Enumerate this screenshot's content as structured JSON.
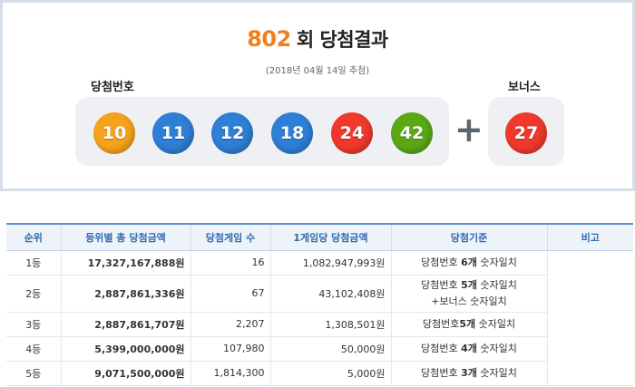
{
  "draw": {
    "number": "802",
    "title_suffix": "회 당첨결과",
    "date": "(2018년 04월 14일 추첨)",
    "main_label": "당첨번호",
    "bonus_label": "보너스",
    "plus_symbol": "+",
    "numbers": [
      "10",
      "11",
      "12",
      "18",
      "24",
      "42"
    ],
    "bonus": "27"
  },
  "ball_colors": {
    "yellow": "#fbc400",
    "blue": "#69c8f2",
    "red": "#ff7272",
    "green": "#b0d840",
    "main": [
      "#f6a21c",
      "#2e7fd6",
      "#2e7fd6",
      "#2e7fd6",
      "#f0392c",
      "#5aa816"
    ],
    "bonus": "#f0392c"
  },
  "table": {
    "headers": [
      "순위",
      "등위별 총 당첨금액",
      "당첨게임 수",
      "1게임당 당첨금액",
      "당첨기준",
      "비고"
    ],
    "rows": [
      {
        "rank": "1등",
        "total": "17,327,167,888원",
        "games": "16",
        "per_game": "1,082,947,993원",
        "criteria_pre": "당첨번호 ",
        "criteria_bold": "6개",
        "criteria_post": " 숫자일치",
        "criteria_line2": ""
      },
      {
        "rank": "2등",
        "total": "2,887,861,336원",
        "games": "67",
        "per_game": "43,102,408원",
        "criteria_pre": "당첨번호 ",
        "criteria_bold": "5개",
        "criteria_post": " 숫자일치",
        "criteria_line2": "+보너스 숫자일치"
      },
      {
        "rank": "3등",
        "total": "2,887,861,707원",
        "games": "2,207",
        "per_game": "1,308,501원",
        "criteria_pre": "당첨번호",
        "criteria_bold": "5개",
        "criteria_post": " 숫자일치",
        "criteria_line2": ""
      },
      {
        "rank": "4등",
        "total": "5,399,000,000원",
        "games": "107,980",
        "per_game": "50,000원",
        "criteria_pre": "당첨번호 ",
        "criteria_bold": "4개",
        "criteria_post": " 숫자일치",
        "criteria_line2": ""
      },
      {
        "rank": "5등",
        "total": "9,071,500,000원",
        "games": "1,814,300",
        "per_game": "5,000원",
        "criteria_pre": "당첨번호 ",
        "criteria_bold": "3개",
        "criteria_post": " 숫자일치",
        "criteria_line2": ""
      }
    ]
  }
}
